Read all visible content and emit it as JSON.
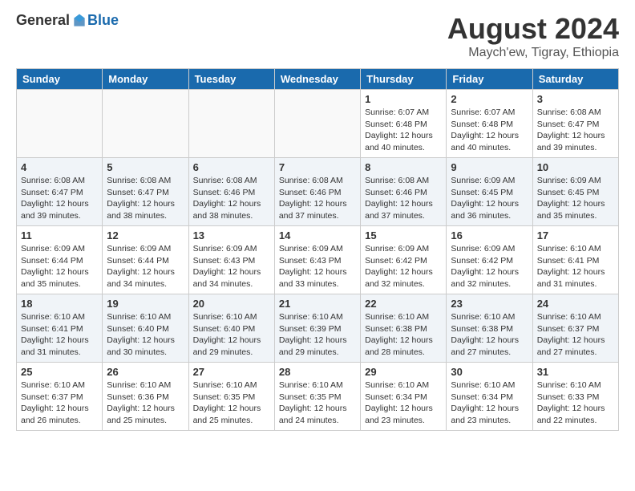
{
  "header": {
    "logo_general": "General",
    "logo_blue": "Blue",
    "month_title": "August 2024",
    "location": "Maych'ew, Tigray, Ethiopia"
  },
  "days_of_week": [
    "Sunday",
    "Monday",
    "Tuesday",
    "Wednesday",
    "Thursday",
    "Friday",
    "Saturday"
  ],
  "weeks": [
    [
      {
        "day": "",
        "info": ""
      },
      {
        "day": "",
        "info": ""
      },
      {
        "day": "",
        "info": ""
      },
      {
        "day": "",
        "info": ""
      },
      {
        "day": "1",
        "info": "Sunrise: 6:07 AM\nSunset: 6:48 PM\nDaylight: 12 hours\nand 40 minutes."
      },
      {
        "day": "2",
        "info": "Sunrise: 6:07 AM\nSunset: 6:48 PM\nDaylight: 12 hours\nand 40 minutes."
      },
      {
        "day": "3",
        "info": "Sunrise: 6:08 AM\nSunset: 6:47 PM\nDaylight: 12 hours\nand 39 minutes."
      }
    ],
    [
      {
        "day": "4",
        "info": "Sunrise: 6:08 AM\nSunset: 6:47 PM\nDaylight: 12 hours\nand 39 minutes."
      },
      {
        "day": "5",
        "info": "Sunrise: 6:08 AM\nSunset: 6:47 PM\nDaylight: 12 hours\nand 38 minutes."
      },
      {
        "day": "6",
        "info": "Sunrise: 6:08 AM\nSunset: 6:46 PM\nDaylight: 12 hours\nand 38 minutes."
      },
      {
        "day": "7",
        "info": "Sunrise: 6:08 AM\nSunset: 6:46 PM\nDaylight: 12 hours\nand 37 minutes."
      },
      {
        "day": "8",
        "info": "Sunrise: 6:08 AM\nSunset: 6:46 PM\nDaylight: 12 hours\nand 37 minutes."
      },
      {
        "day": "9",
        "info": "Sunrise: 6:09 AM\nSunset: 6:45 PM\nDaylight: 12 hours\nand 36 minutes."
      },
      {
        "day": "10",
        "info": "Sunrise: 6:09 AM\nSunset: 6:45 PM\nDaylight: 12 hours\nand 35 minutes."
      }
    ],
    [
      {
        "day": "11",
        "info": "Sunrise: 6:09 AM\nSunset: 6:44 PM\nDaylight: 12 hours\nand 35 minutes."
      },
      {
        "day": "12",
        "info": "Sunrise: 6:09 AM\nSunset: 6:44 PM\nDaylight: 12 hours\nand 34 minutes."
      },
      {
        "day": "13",
        "info": "Sunrise: 6:09 AM\nSunset: 6:43 PM\nDaylight: 12 hours\nand 34 minutes."
      },
      {
        "day": "14",
        "info": "Sunrise: 6:09 AM\nSunset: 6:43 PM\nDaylight: 12 hours\nand 33 minutes."
      },
      {
        "day": "15",
        "info": "Sunrise: 6:09 AM\nSunset: 6:42 PM\nDaylight: 12 hours\nand 32 minutes."
      },
      {
        "day": "16",
        "info": "Sunrise: 6:09 AM\nSunset: 6:42 PM\nDaylight: 12 hours\nand 32 minutes."
      },
      {
        "day": "17",
        "info": "Sunrise: 6:10 AM\nSunset: 6:41 PM\nDaylight: 12 hours\nand 31 minutes."
      }
    ],
    [
      {
        "day": "18",
        "info": "Sunrise: 6:10 AM\nSunset: 6:41 PM\nDaylight: 12 hours\nand 31 minutes."
      },
      {
        "day": "19",
        "info": "Sunrise: 6:10 AM\nSunset: 6:40 PM\nDaylight: 12 hours\nand 30 minutes."
      },
      {
        "day": "20",
        "info": "Sunrise: 6:10 AM\nSunset: 6:40 PM\nDaylight: 12 hours\nand 29 minutes."
      },
      {
        "day": "21",
        "info": "Sunrise: 6:10 AM\nSunset: 6:39 PM\nDaylight: 12 hours\nand 29 minutes."
      },
      {
        "day": "22",
        "info": "Sunrise: 6:10 AM\nSunset: 6:38 PM\nDaylight: 12 hours\nand 28 minutes."
      },
      {
        "day": "23",
        "info": "Sunrise: 6:10 AM\nSunset: 6:38 PM\nDaylight: 12 hours\nand 27 minutes."
      },
      {
        "day": "24",
        "info": "Sunrise: 6:10 AM\nSunset: 6:37 PM\nDaylight: 12 hours\nand 27 minutes."
      }
    ],
    [
      {
        "day": "25",
        "info": "Sunrise: 6:10 AM\nSunset: 6:37 PM\nDaylight: 12 hours\nand 26 minutes."
      },
      {
        "day": "26",
        "info": "Sunrise: 6:10 AM\nSunset: 6:36 PM\nDaylight: 12 hours\nand 25 minutes."
      },
      {
        "day": "27",
        "info": "Sunrise: 6:10 AM\nSunset: 6:35 PM\nDaylight: 12 hours\nand 25 minutes."
      },
      {
        "day": "28",
        "info": "Sunrise: 6:10 AM\nSunset: 6:35 PM\nDaylight: 12 hours\nand 24 minutes."
      },
      {
        "day": "29",
        "info": "Sunrise: 6:10 AM\nSunset: 6:34 PM\nDaylight: 12 hours\nand 23 minutes."
      },
      {
        "day": "30",
        "info": "Sunrise: 6:10 AM\nSunset: 6:34 PM\nDaylight: 12 hours\nand 23 minutes."
      },
      {
        "day": "31",
        "info": "Sunrise: 6:10 AM\nSunset: 6:33 PM\nDaylight: 12 hours\nand 22 minutes."
      }
    ]
  ]
}
